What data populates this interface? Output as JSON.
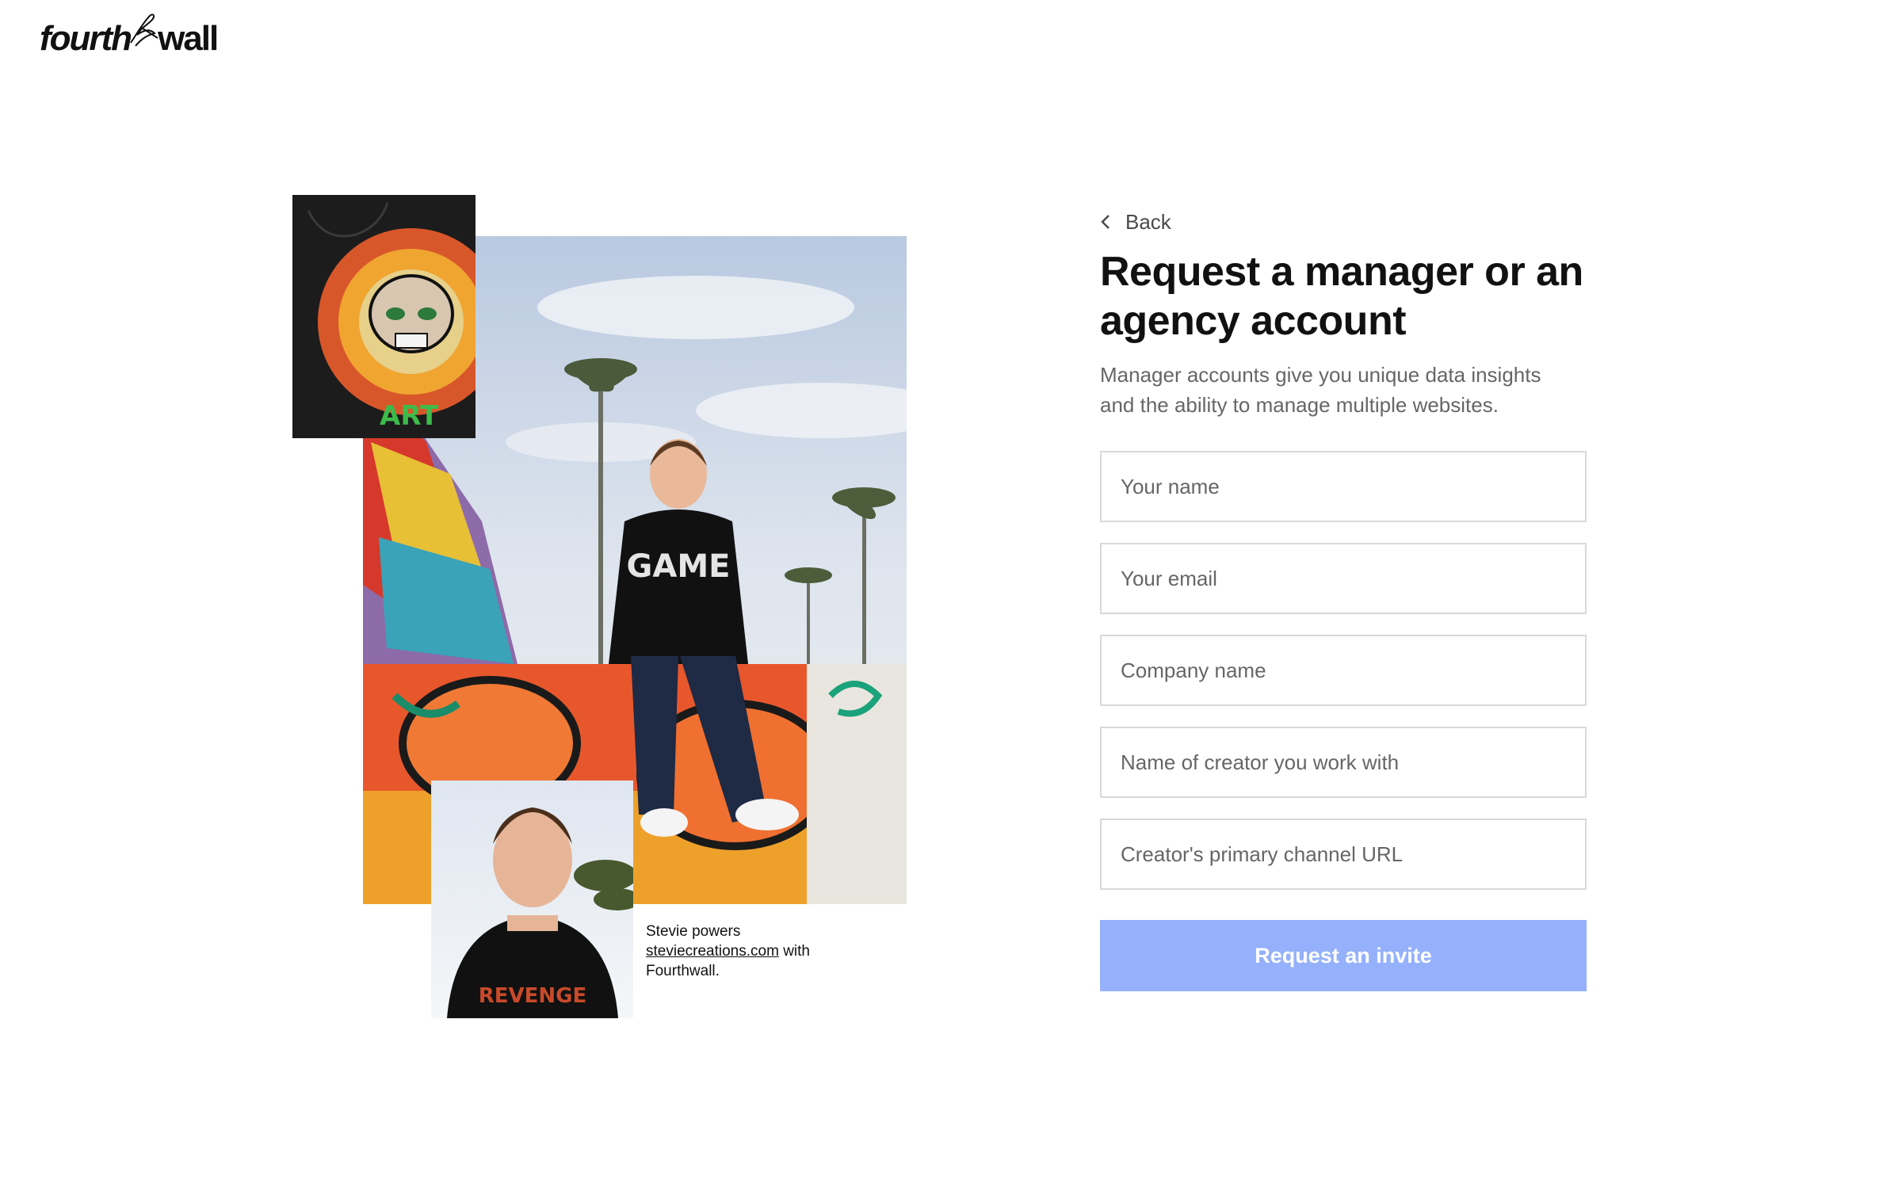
{
  "brand": {
    "left_word": "fourth",
    "right_word": "wall",
    "mark_icon": "signature-icon"
  },
  "back": {
    "label": "Back"
  },
  "form": {
    "title": "Request a manager or an agency account",
    "subtitle": "Manager accounts give you unique data insights and the ability to manage multiple websites.",
    "fields": {
      "name": "Your name",
      "email": "Your email",
      "company": "Company name",
      "creator": "Name of creator you work with",
      "channel_url": "Creator's primary channel URL"
    },
    "submit_label": "Request an invite"
  },
  "caption": {
    "prefix": "Stevie powers",
    "link_text": "steviecreations.com",
    "suffix": "with Fourthwall."
  },
  "colors": {
    "button": "#95b1fc",
    "text": "#111111",
    "muted": "#666666",
    "border": "#d9d9d9"
  }
}
